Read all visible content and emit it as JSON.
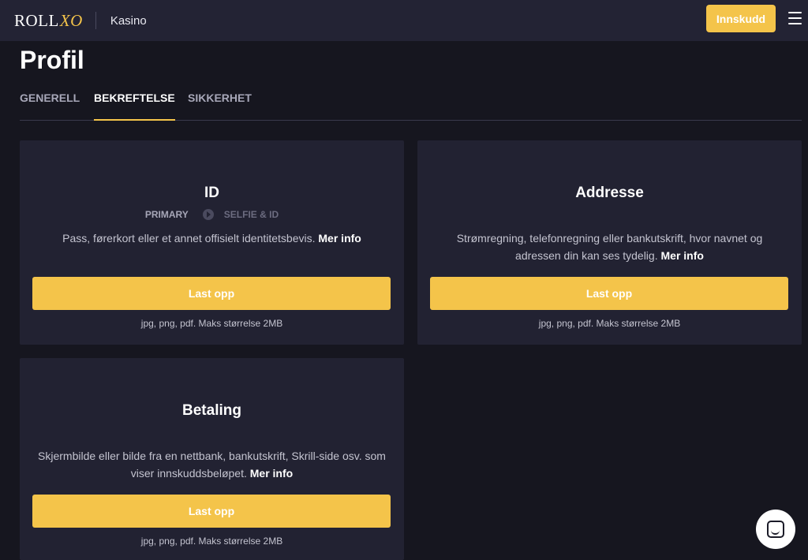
{
  "header": {
    "logo_text": "ROLL",
    "logo_mark": "XO",
    "section": "Kasino",
    "deposit_label": "Innskudd",
    "menu_icon": "hamburger-icon"
  },
  "page": {
    "title": "Profil"
  },
  "tabs": [
    {
      "label": "GENERELL",
      "active": false
    },
    {
      "label": "BEKREFTELSE",
      "active": true
    },
    {
      "label": "SIKKERHET",
      "active": false
    }
  ],
  "cards": {
    "id": {
      "title": "ID",
      "step_primary": "PRIMARY",
      "step_secondary": "SELFIE & ID",
      "description": "Pass, førerkort eller et annet offisielt identitetsbevis.",
      "more_info": "Mer info",
      "upload_label": "Last opp",
      "hint": "jpg, png, pdf. Maks størrelse 2MB"
    },
    "address": {
      "title": "Addresse",
      "description": "Strømregning, telefonregning eller bankutskrift, hvor navnet og adressen din kan ses tydelig.",
      "more_info": "Mer info",
      "upload_label": "Last opp",
      "hint": "jpg, png, pdf. Maks størrelse 2MB"
    },
    "payment": {
      "title": "Betaling",
      "description": "Skjermbilde eller bilde fra en nettbank, bankutskrift, Skrill-side osv. som viser innskuddsbeløpet.",
      "more_info": "Mer info",
      "upload_label": "Last opp",
      "hint": "jpg, png, pdf. Maks størrelse 2MB"
    }
  },
  "colors": {
    "accent": "#f4c44a",
    "background": "#16161f",
    "card": "#222232",
    "header": "#232334"
  }
}
